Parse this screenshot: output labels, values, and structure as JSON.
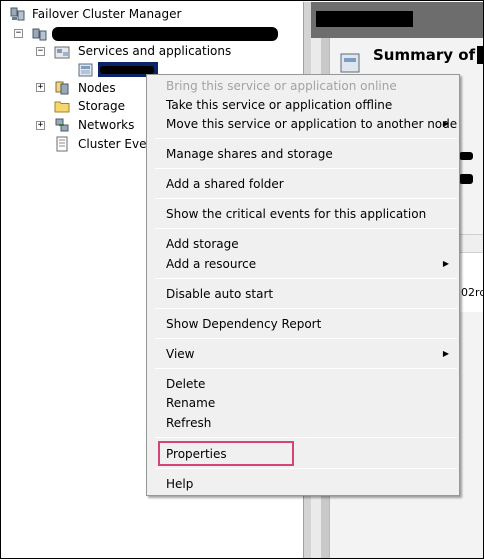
{
  "tree": {
    "root_label": "Failover Cluster Manager",
    "services_label": "Services and applications",
    "nodes_label": "Nodes",
    "storage_label": "Storage",
    "networks_label": "Networks",
    "events_label": "Cluster Eve",
    "expand_symbol": "+",
    "collapse_symbol": "−"
  },
  "right": {
    "summary_title": "Summary of",
    "fragment": "02rd"
  },
  "menu": {
    "items": [
      {
        "label": "Bring this service or application online",
        "enabled": false
      },
      {
        "label": "Take this service or application offline",
        "enabled": true
      },
      {
        "label": "Move this service or application to another node",
        "enabled": true,
        "submenu": true
      },
      {
        "label": "Manage shares and storage",
        "enabled": true
      },
      {
        "label": "Add a shared folder",
        "enabled": true
      },
      {
        "label": "Show the critical events for this application",
        "enabled": true
      },
      {
        "label": "Add storage",
        "enabled": true
      },
      {
        "label": "Add a resource",
        "enabled": true,
        "submenu": true
      },
      {
        "label": "Disable auto start",
        "enabled": true
      },
      {
        "label": "Show Dependency Report",
        "enabled": true
      },
      {
        "label": "View",
        "enabled": true,
        "submenu": true
      },
      {
        "label": "Delete",
        "enabled": true
      },
      {
        "label": "Rename",
        "enabled": true
      },
      {
        "label": "Refresh",
        "enabled": true
      },
      {
        "label": "Properties",
        "enabled": true
      },
      {
        "label": "Help",
        "enabled": true
      }
    ],
    "submenu_arrow": "▶"
  },
  "colors": {
    "highlight_box": "#d6427a",
    "selection": "#0a246a",
    "disabled_text": "#a3a3a3"
  }
}
